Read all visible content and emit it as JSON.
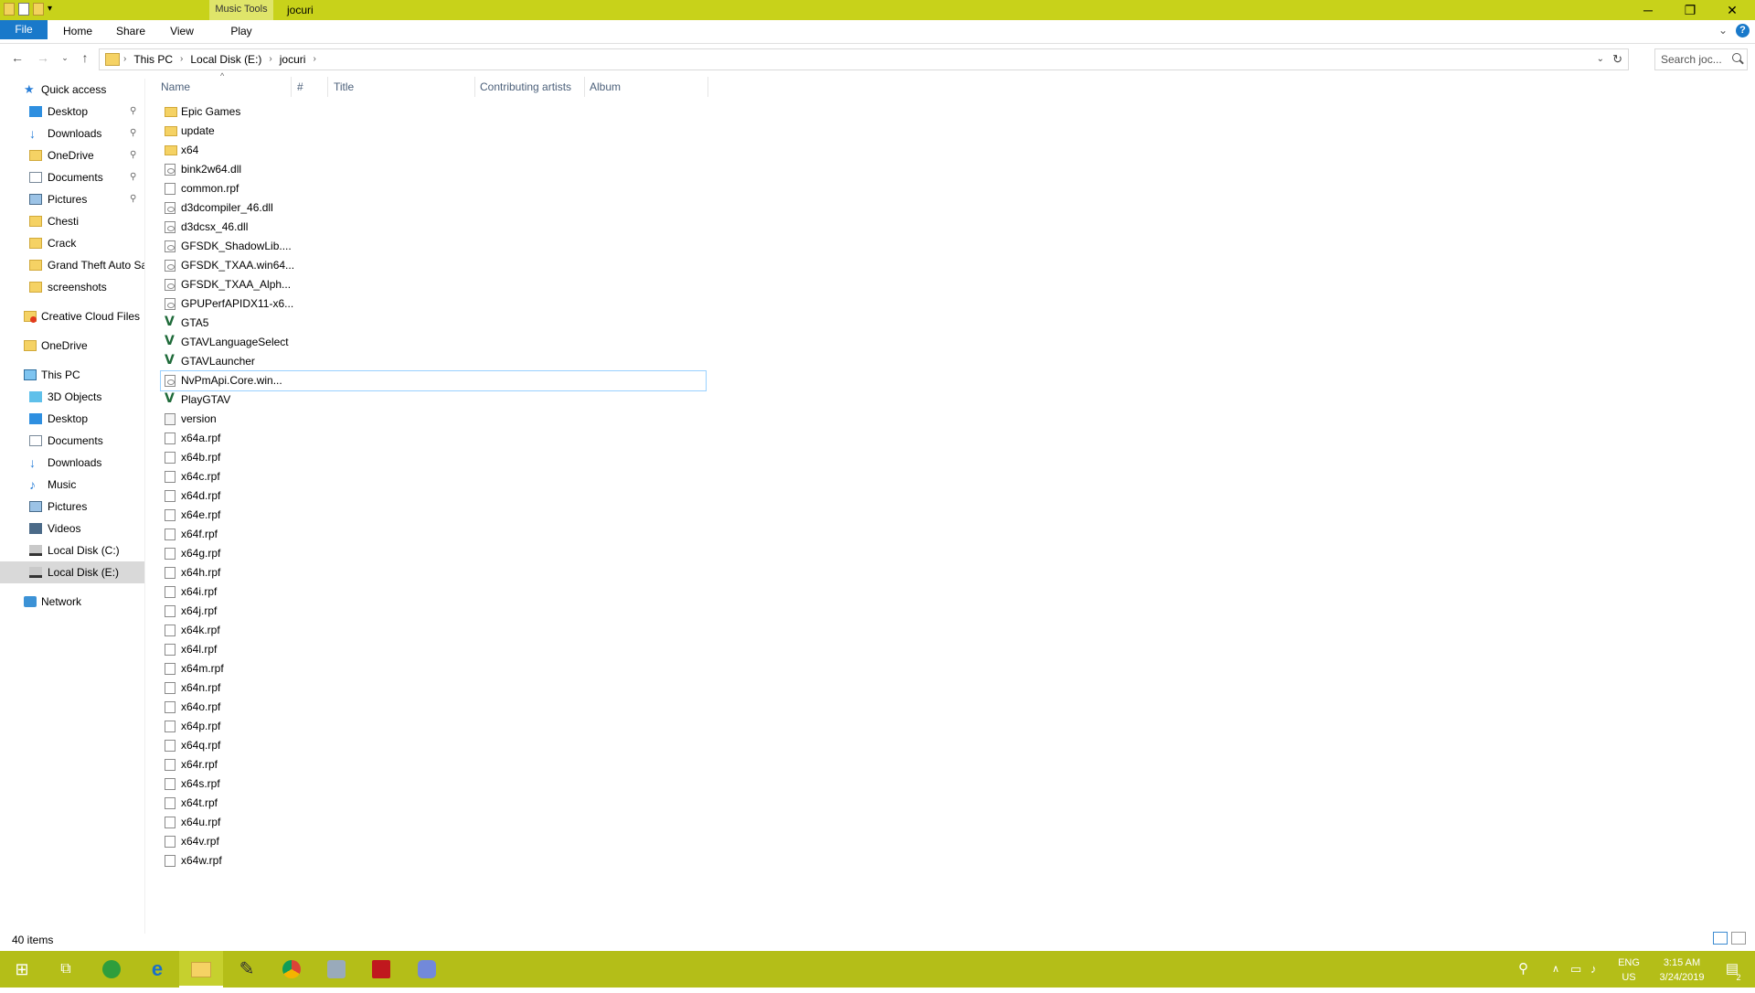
{
  "window": {
    "title": "jocuri",
    "context_tab": "Music Tools",
    "controls": {
      "minimize": "─",
      "restore": "❐",
      "close": "✕"
    }
  },
  "ribbon": {
    "tabs": [
      "File",
      "Home",
      "Share",
      "View",
      "Play"
    ],
    "collapse_icon": "chevron-down-icon",
    "help_glyph": "?"
  },
  "address": {
    "crumbs": [
      "This PC",
      "Local Disk (E:)",
      "jocuri"
    ],
    "search_placeholder": "Search joc..."
  },
  "nav_pane": {
    "items": [
      {
        "label": "Quick access",
        "icon": "star-icon",
        "level": 0,
        "pinned": false
      },
      {
        "label": "Desktop",
        "icon": "desktop-icon",
        "level": 1,
        "pinned": true
      },
      {
        "label": "Downloads",
        "icon": "downloads-icon",
        "level": 1,
        "pinned": true
      },
      {
        "label": "OneDrive",
        "icon": "folder-icon",
        "level": 1,
        "pinned": true
      },
      {
        "label": "Documents",
        "icon": "documents-icon",
        "level": 1,
        "pinned": true
      },
      {
        "label": "Pictures",
        "icon": "pictures-icon",
        "level": 1,
        "pinned": true
      },
      {
        "label": "Chesti",
        "icon": "folder-icon",
        "level": 1,
        "pinned": false
      },
      {
        "label": "Crack",
        "icon": "folder-icon",
        "level": 1,
        "pinned": false
      },
      {
        "label": "Grand Theft Auto San Andreas",
        "icon": "folder-icon",
        "level": 1,
        "pinned": false
      },
      {
        "label": "screenshots",
        "icon": "folder-icon",
        "level": 1,
        "pinned": false
      },
      {
        "label": "Creative Cloud Files",
        "icon": "creative-cloud-icon",
        "level": 0,
        "pinned": false
      },
      {
        "label": "OneDrive",
        "icon": "onedrive-icon",
        "level": 0,
        "pinned": false
      },
      {
        "label": "This PC",
        "icon": "pc-icon",
        "level": 0,
        "pinned": false
      },
      {
        "label": "3D Objects",
        "icon": "cube-icon",
        "level": 1,
        "pinned": false
      },
      {
        "label": "Desktop",
        "icon": "desktop-icon",
        "level": 1,
        "pinned": false
      },
      {
        "label": "Documents",
        "icon": "documents-icon",
        "level": 1,
        "pinned": false
      },
      {
        "label": "Downloads",
        "icon": "downloads-icon",
        "level": 1,
        "pinned": false
      },
      {
        "label": "Music",
        "icon": "music-icon",
        "level": 1,
        "pinned": false
      },
      {
        "label": "Pictures",
        "icon": "pictures-icon",
        "level": 1,
        "pinned": false
      },
      {
        "label": "Videos",
        "icon": "videos-icon",
        "level": 1,
        "pinned": false
      },
      {
        "label": "Local Disk (C:)",
        "icon": "drive-icon",
        "level": 1,
        "pinned": false
      },
      {
        "label": "Local Disk (E:)",
        "icon": "drive-icon",
        "level": 1,
        "pinned": false,
        "selected": true
      },
      {
        "label": "Network",
        "icon": "network-icon",
        "level": 0,
        "pinned": false
      }
    ]
  },
  "columns": [
    "Name",
    "#",
    "Title",
    "Contributing artists",
    "Album"
  ],
  "files": [
    {
      "name": "Epic Games",
      "type": "folder"
    },
    {
      "name": "update",
      "type": "folder"
    },
    {
      "name": "x64",
      "type": "folder"
    },
    {
      "name": "bink2w64.dll",
      "type": "dll"
    },
    {
      "name": "common.rpf",
      "type": "file"
    },
    {
      "name": "d3dcompiler_46.dll",
      "type": "dll"
    },
    {
      "name": "d3dcsx_46.dll",
      "type": "dll"
    },
    {
      "name": "GFSDK_ShadowLib....",
      "type": "dll"
    },
    {
      "name": "GFSDK_TXAA.win64...",
      "type": "dll"
    },
    {
      "name": "GFSDK_TXAA_Alph...",
      "type": "dll"
    },
    {
      "name": "GPUPerfAPIDX11-x6...",
      "type": "dll"
    },
    {
      "name": "GTA5",
      "type": "exe"
    },
    {
      "name": "GTAVLanguageSelect",
      "type": "exe"
    },
    {
      "name": "GTAVLauncher",
      "type": "exe"
    },
    {
      "name": "NvPmApi.Core.win...",
      "type": "dll",
      "focused": true
    },
    {
      "name": "PlayGTAV",
      "type": "exe"
    },
    {
      "name": "version",
      "type": "txt"
    },
    {
      "name": "x64a.rpf",
      "type": "file"
    },
    {
      "name": "x64b.rpf",
      "type": "file"
    },
    {
      "name": "x64c.rpf",
      "type": "file"
    },
    {
      "name": "x64d.rpf",
      "type": "file"
    },
    {
      "name": "x64e.rpf",
      "type": "file"
    },
    {
      "name": "x64f.rpf",
      "type": "file"
    },
    {
      "name": "x64g.rpf",
      "type": "file"
    },
    {
      "name": "x64h.rpf",
      "type": "file"
    },
    {
      "name": "x64i.rpf",
      "type": "file"
    },
    {
      "name": "x64j.rpf",
      "type": "file"
    },
    {
      "name": "x64k.rpf",
      "type": "file"
    },
    {
      "name": "x64l.rpf",
      "type": "file"
    },
    {
      "name": "x64m.rpf",
      "type": "file"
    },
    {
      "name": "x64n.rpf",
      "type": "file"
    },
    {
      "name": "x64o.rpf",
      "type": "file"
    },
    {
      "name": "x64p.rpf",
      "type": "file"
    },
    {
      "name": "x64q.rpf",
      "type": "file"
    },
    {
      "name": "x64r.rpf",
      "type": "file"
    },
    {
      "name": "x64s.rpf",
      "type": "file"
    },
    {
      "name": "x64t.rpf",
      "type": "file"
    },
    {
      "name": "x64u.rpf",
      "type": "file"
    },
    {
      "name": "x64v.rpf",
      "type": "file"
    },
    {
      "name": "x64w.rpf",
      "type": "file"
    }
  ],
  "status": {
    "item_count": "40 items"
  },
  "taskbar": {
    "apps": [
      "start-icon",
      "task-view-icon",
      "utorrent-icon",
      "edge-icon",
      "file-explorer-icon",
      "app-icon",
      "chrome-icon",
      "app-icon",
      "app-icon",
      "discord-icon"
    ],
    "language": "ENG",
    "region": "US",
    "time": "3:15 AM",
    "date": "3/24/2019",
    "notification_count": "2"
  },
  "colors": {
    "accent": "#c8d21a",
    "taskbar": "#b4be18",
    "file_tab": "#1979ca"
  }
}
